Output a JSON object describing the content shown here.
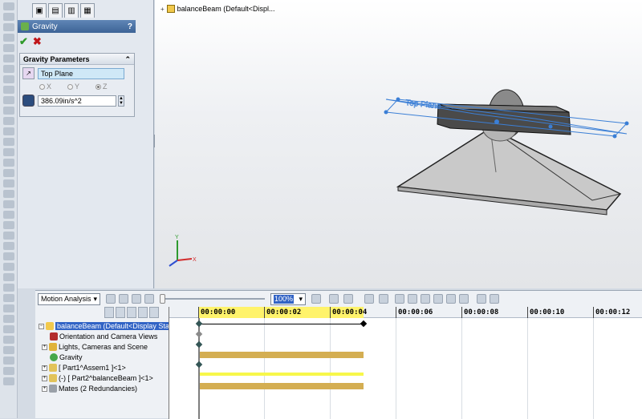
{
  "property_manager": {
    "title": "Gravity",
    "help": "?",
    "group_title": "Gravity Parameters",
    "collapse_glyph": "⌃",
    "direction_reference": "Top Plane",
    "axes": [
      "X",
      "Y",
      "Z"
    ],
    "selected_axis": "Z",
    "gravity_value": "386.09in/s^2"
  },
  "tree_header": {
    "label": "balanceBeam  (Default<Displ..."
  },
  "sketch_label": "Top Plane",
  "axes_labels": {
    "x": "X",
    "y": "Y"
  },
  "motion": {
    "study_type": "Motion Analysis",
    "zoom": "100%",
    "ruler": [
      "00:00:00",
      "00:00:02",
      "00:00:04",
      "00:00:06",
      "00:00:08",
      "00:00:10",
      "00:00:12"
    ],
    "tree": [
      {
        "label": "balanceBeam  (Default<Display State-1"
      },
      {
        "label": "Orientation and Camera Views"
      },
      {
        "label": "Lights, Cameras and Scene"
      },
      {
        "label": "Gravity"
      },
      {
        "label": "[ Part1^Assem1 ]<1>"
      },
      {
        "label": "(-) [ Part2^balanceBeam ]<1>"
      },
      {
        "label": "Mates (2 Redundancies)"
      }
    ]
  },
  "colors": {
    "header_blue": "#3d6396",
    "selection_blue": "#3163c5",
    "timeline_highlight": "#fff36b",
    "bar_gold": "#d4ae52",
    "bar_yellow": "#f7f74a"
  }
}
